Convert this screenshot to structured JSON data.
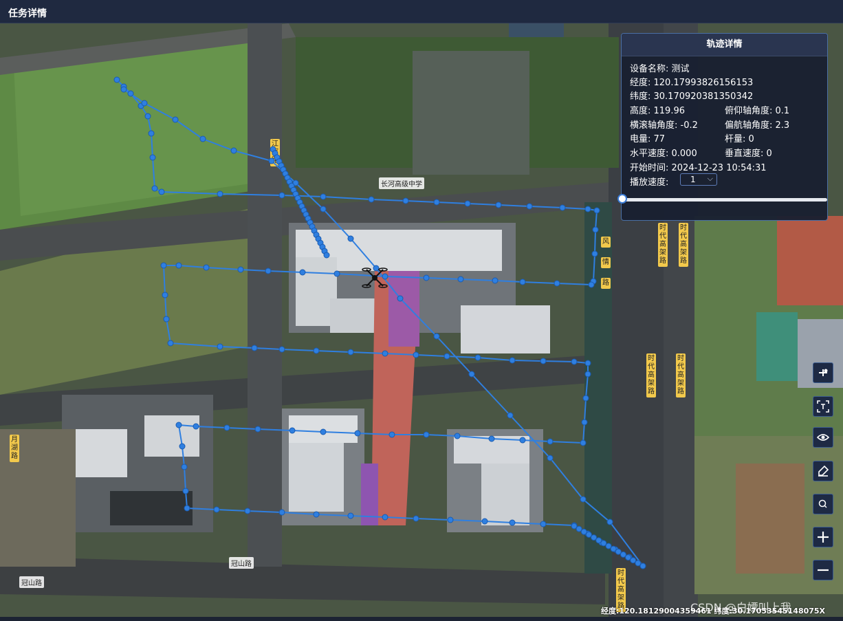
{
  "header": {
    "title": "任务详情"
  },
  "map": {
    "labels": {
      "road_tianmu": "天目山路",
      "road_guanshan_a": "冠山路",
      "road_guanshan_b": "冠山路",
      "road_yuehu": "月湖路",
      "school": "长河高级中学",
      "road_feng": "风",
      "road_feng2": "情",
      "road_feng3": "路",
      "road_shidai_a": "时代高架路",
      "road_shidai_b": "时代高架路",
      "road_shidai_c": "时代高架路",
      "road_shidai_d": "时代高架路",
      "road_shidai_e": "时代高架路",
      "road_left": "江晖路"
    },
    "track_color": "#2f7fe0"
  },
  "track_panel": {
    "title": "轨迹详情",
    "device_name": "设备名称: 测试",
    "longitude": "经度: 120.17993826156153",
    "latitude": "纬度: 30.170920381350342",
    "altitude": "高度: 119.96",
    "pitch": "俯仰轴角度: 0.1",
    "roll": "横滚轴角度: -0.2",
    "yaw": "偏航轴角度: 2.3",
    "battery": "电量: 77",
    "stick": "杆量: 0",
    "h_speed": "水平速度: 0.000",
    "v_speed": "垂直速度: 0",
    "start_time": "开始时间: 2024-12-23 10:54:31",
    "speed_label": "播放速度:",
    "speed_value": "1",
    "progress": 0.0
  },
  "tools": [
    {
      "name": "drone-icon"
    },
    {
      "name": "fit-view-icon"
    },
    {
      "name": "eye-icon"
    },
    {
      "name": "clear-icon"
    },
    {
      "name": "search-icon"
    },
    {
      "name": "zoom-in-icon"
    },
    {
      "name": "zoom-out-icon"
    }
  ],
  "status": {
    "coords": "经度:120.18129004359461  纬度:30.17053545148075X",
    "watermark": "CSDN @白嫖叫上我"
  }
}
